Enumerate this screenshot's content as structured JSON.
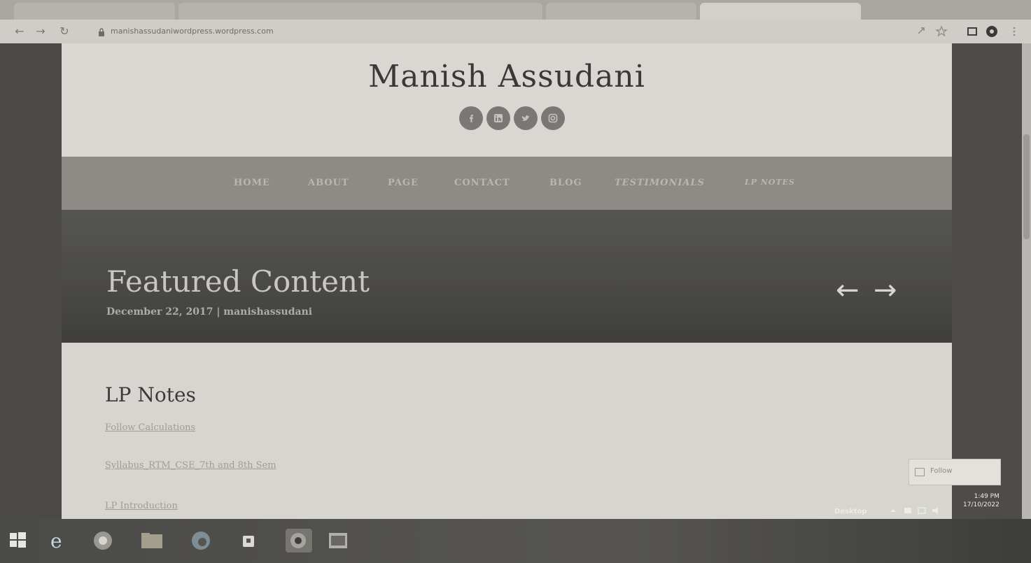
{
  "browser": {
    "url": "manishassudaniwordpress.wordpress.com"
  },
  "site": {
    "title": "Manish Assudani",
    "socials": [
      "facebook-icon",
      "linkedin-icon",
      "twitter-icon",
      "instagram-icon"
    ],
    "menu": [
      "HOME",
      "ABOUT",
      "PAGE",
      "CONTACT",
      "BLOG",
      "TESTIMONIALS",
      "LP NOTES"
    ]
  },
  "hero": {
    "title": "Featured Content",
    "date": "December 22, 2017",
    "separator": "|",
    "author": "manishassudani",
    "prev_arrow": "←",
    "next_arrow": "→"
  },
  "content": {
    "section_title": "LP Notes",
    "links": [
      "Follow Calculations",
      "Syllabus_RTM_CSE_7th and 8th Sem",
      "LP Introduction"
    ]
  },
  "follow_button": {
    "label": "Follow"
  },
  "taskbar": {
    "desktop_label": "Desktop",
    "time": "1:49 PM",
    "date": "17/10/2022"
  },
  "colors": {
    "header_bg": "#d9d7d2",
    "menu_bg": "#8d8b86",
    "hero_bg": "#4b4a47",
    "content_bg": "#d7d5d0"
  }
}
